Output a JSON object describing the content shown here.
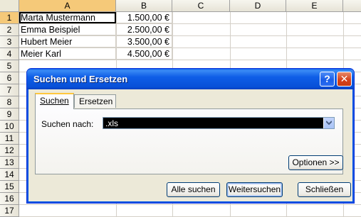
{
  "sheet": {
    "columns": [
      "A",
      "B",
      "C",
      "D",
      "E"
    ],
    "rows": [
      "1",
      "2",
      "3",
      "4",
      "5",
      "6",
      "7",
      "8",
      "9",
      "10",
      "11",
      "12",
      "13",
      "14",
      "15",
      "16",
      "17"
    ],
    "cells": [
      {
        "name": "Marta Mustermann",
        "amount": "1.500,00 €"
      },
      {
        "name": "Emma Beispiel",
        "amount": "2.500,00 €"
      },
      {
        "name": "Hubert Meier",
        "amount": "3.500,00 €"
      },
      {
        "name": "Meier Karl",
        "amount": "4.500,00 €"
      }
    ]
  },
  "dialog": {
    "title": "Suchen und Ersetzen",
    "help_label": "?",
    "close_label": "✕",
    "tabs": {
      "suchen": "Suchen",
      "ersetzen": "Ersetzen"
    },
    "search_label": "Suchen nach:",
    "search_value": ".xls",
    "options_button": "Optionen >>",
    "find_all_button": "Alle suchen",
    "find_next_button": "Weitersuchen",
    "close_button": "Schließen"
  },
  "icons": {
    "help": "help-icon",
    "close": "close-icon",
    "dropdown": "chevron-down-icon"
  },
  "colors": {
    "title_bar": "#0850d8",
    "selection": "#f5c979",
    "combo_bg": "#000000"
  }
}
